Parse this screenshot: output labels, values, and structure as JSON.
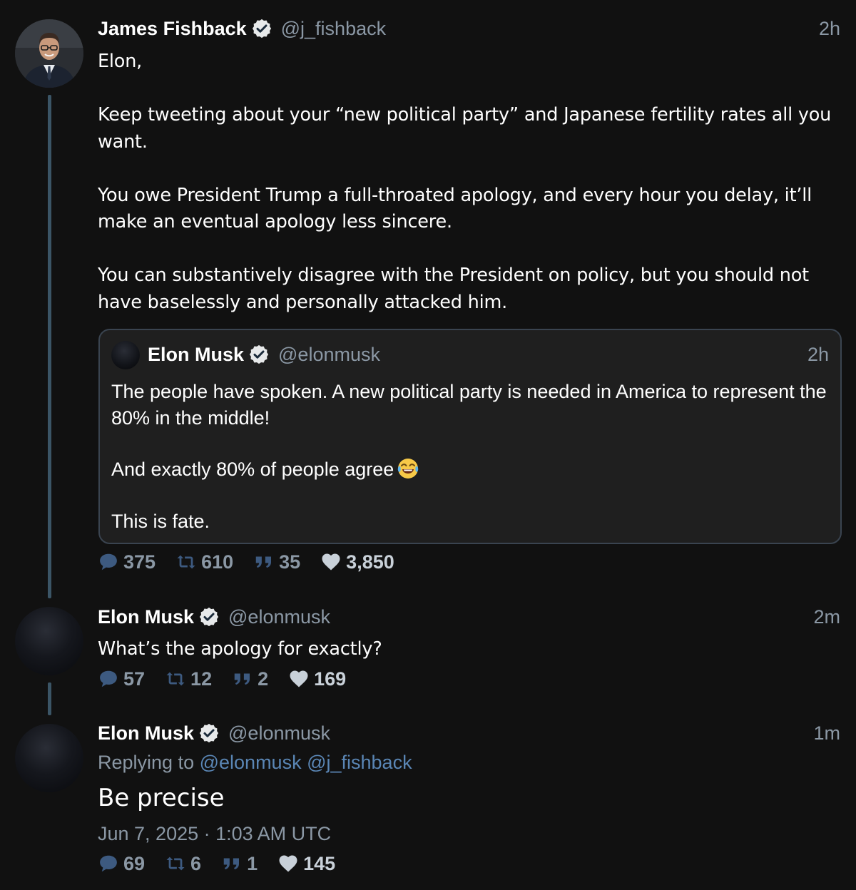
{
  "colors": {
    "background": "#111111",
    "thread_line": "#3b5566",
    "text_primary": "#ffffff",
    "text_secondary": "#8b98a5",
    "mention": "#5a86b5",
    "verified_badge": "#e7e9ea",
    "quote_background": "#1f1f1f",
    "quote_border": "#3a4450"
  },
  "tweet1": {
    "author": {
      "name": "James Fishback",
      "handle": "@j_fishback",
      "avatar_icon": "person-photo-avatar"
    },
    "time": "2h",
    "paragraphs": [
      "Elon,",
      "Keep tweeting about your “new political party” and Japanese fertility rates all you want.",
      "You owe President Trump a full-throated apology, and every hour you delay, it’ll make an eventual apology less sincere.",
      "You can substantively disagree with the President on policy, but you should not have baselessly and personally attacked him."
    ],
    "quote": {
      "author": {
        "name": "Elon Musk",
        "handle": "@elonmusk"
      },
      "time": "2h",
      "paragraphs": [
        "The people have spoken. A new political party is needed in America to represent the 80% in the middle!",
        "And exactly 80% of people agree",
        "This is fate."
      ],
      "emoji": "face-with-tears-of-joy-icon"
    },
    "stats": {
      "replies": "375",
      "retweets": "610",
      "quotes": "35",
      "likes": "3,850"
    }
  },
  "tweet2": {
    "author": {
      "name": "Elon Musk",
      "handle": "@elonmusk"
    },
    "time": "2m",
    "text": "What’s the apology for exactly?",
    "stats": {
      "replies": "57",
      "retweets": "12",
      "quotes": "2",
      "likes": "169"
    }
  },
  "tweet3": {
    "author": {
      "name": "Elon Musk",
      "handle": "@elonmusk"
    },
    "time": "1m",
    "replying_label": "Replying to",
    "replying_to": [
      "@elonmusk",
      "@j_fishback"
    ],
    "text": "Be precise",
    "timestamp": "Jun 7, 2025 · 1:03 AM UTC",
    "stats": {
      "replies": "69",
      "retweets": "6",
      "quotes": "1",
      "likes": "145"
    }
  }
}
